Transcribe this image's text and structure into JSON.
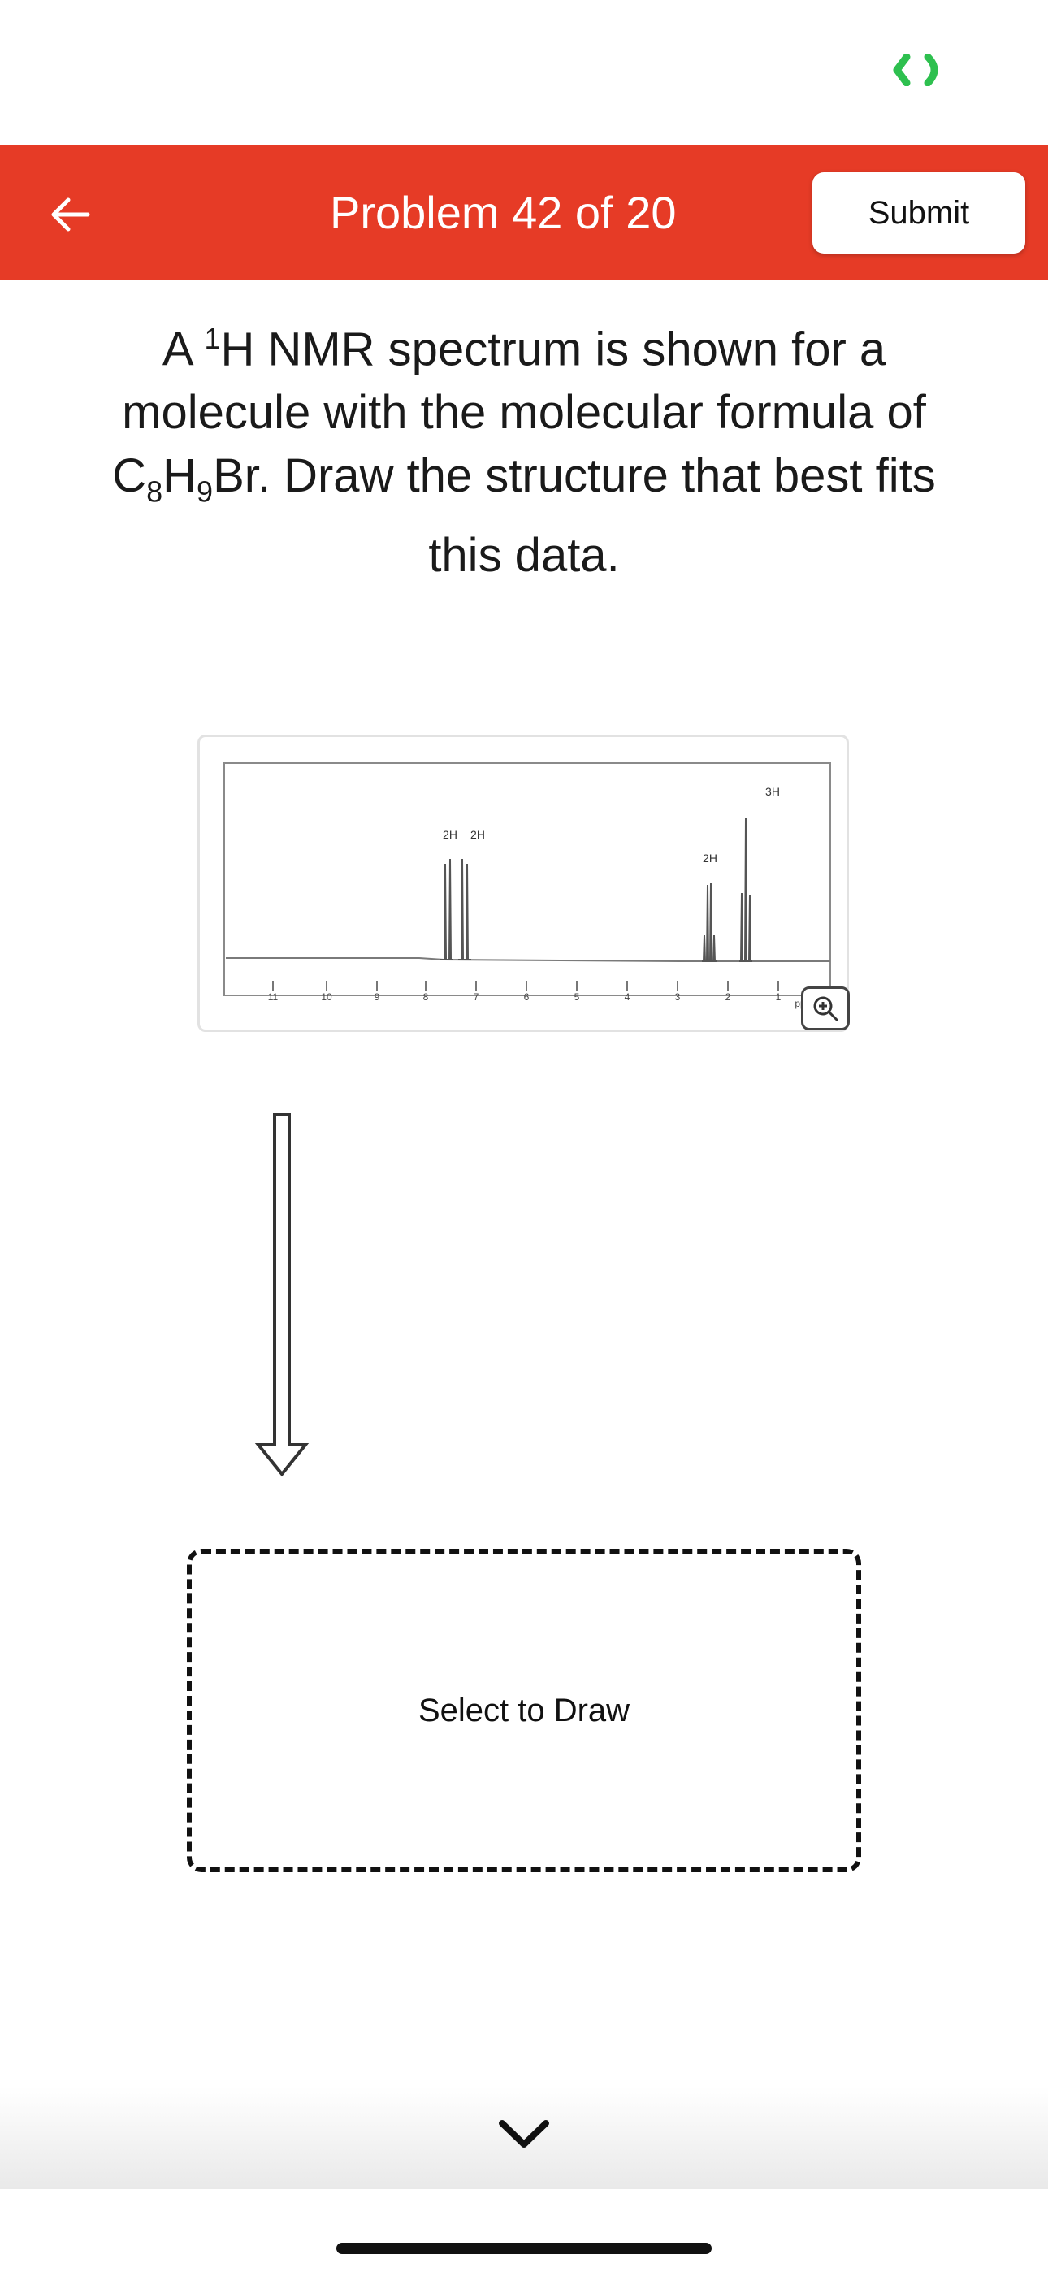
{
  "header": {
    "title": "Problem 42 of 20",
    "submit_label": "Submit",
    "color": "#e63b26"
  },
  "question": {
    "line1_pre": "A ",
    "line1_sup": "1",
    "line1_post": "H NMR spectrum is shown for a",
    "line2": "molecule with the molecular formula of",
    "line3_parts": [
      "C",
      "8",
      "H",
      "9",
      "Br. Draw the structure that best fits"
    ],
    "line4": "this data."
  },
  "spectrum": {
    "axis_ticks": [
      "11",
      "10",
      "9",
      "8",
      "7",
      "6",
      "5",
      "4",
      "3",
      "2",
      "1"
    ],
    "axis_unit": "ppm",
    "peak_labels": [
      "2H",
      "2H",
      "2H",
      "3H"
    ]
  },
  "draw_area": {
    "label": "Select to Draw"
  },
  "icons": {
    "back": "arrow-left-icon",
    "zoom": "zoom-in-icon",
    "chevron": "chevron-down-icon",
    "status": "connection-indicator-icon"
  },
  "colors": {
    "accent": "#e63b26",
    "status_green": "#2ec04f"
  }
}
